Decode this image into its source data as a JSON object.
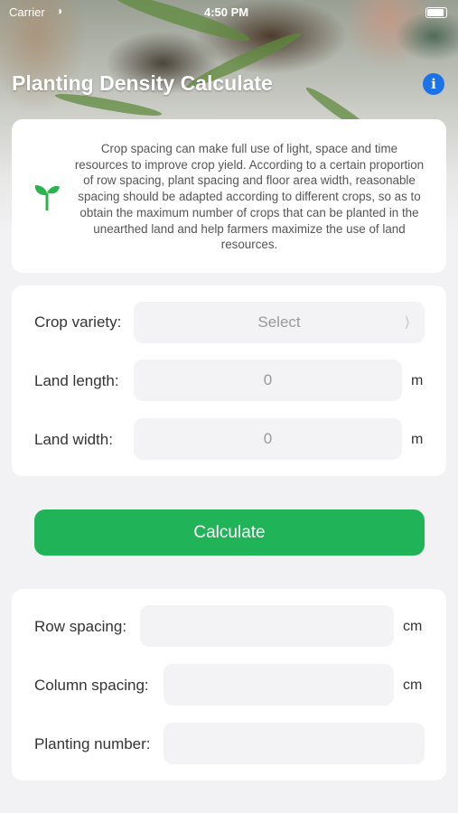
{
  "status_bar": {
    "carrier": "Carrier",
    "time": "4:50 PM"
  },
  "header": {
    "title": "Planting Density Calculate",
    "info_icon": "info-icon"
  },
  "intro": {
    "icon": "sprout-icon",
    "text": "Crop spacing can make full use of light, space and time resources to improve crop yield. According to a certain proportion of row spacing, plant spacing and floor area width, reasonable spacing should be adapted according to different crops, so as to obtain the maximum number of crops that can be planted in the unearthed land and help farmers maximize the use of land resources."
  },
  "form": {
    "crop_variety_label": "Crop variety:",
    "crop_variety_value": "Select",
    "land_length_label": "Land length:",
    "land_length_value": "0",
    "land_length_unit": "m",
    "land_width_label": "Land width:",
    "land_width_value": "0",
    "land_width_unit": "m"
  },
  "actions": {
    "calculate_label": "Calculate"
  },
  "results": {
    "row_spacing_label": "Row spacing:",
    "row_spacing_unit": "cm",
    "column_spacing_label": "Column spacing:",
    "column_spacing_unit": "cm",
    "planting_number_label": "Planting number:"
  },
  "colors": {
    "accent": "#21b357",
    "info": "#1a73e8"
  }
}
